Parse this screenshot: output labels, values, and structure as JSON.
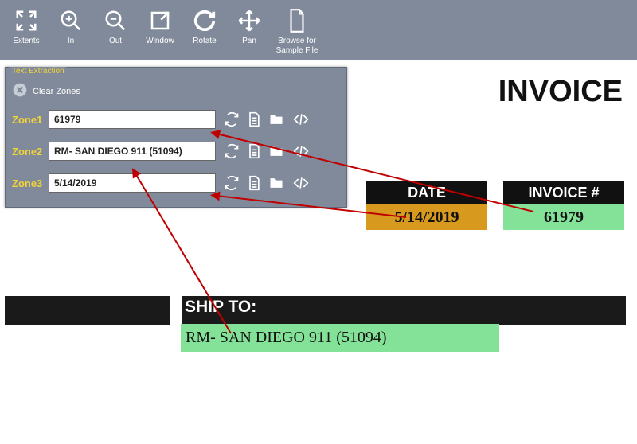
{
  "toolbar": {
    "extents": "Extents",
    "in": "In",
    "out": "Out",
    "window": "Window",
    "rotate": "Rotate",
    "pan": "Pan",
    "browse": "Browse for Sample File"
  },
  "panel": {
    "legend": "Text Extraction",
    "clear": "Clear Zones",
    "rows": [
      {
        "label": "Zone1",
        "value": "61979"
      },
      {
        "label": "Zone2",
        "value": "RM- SAN DIEGO 911 (51094)"
      },
      {
        "label": "Zone3",
        "value": "5/14/2019"
      }
    ]
  },
  "doc": {
    "title": "INVOICE",
    "date_label": "DATE",
    "invoice_label": "INVOICE #",
    "date_value": "5/14/2019",
    "invoice_value": "61979",
    "shipto_label": "SHIP TO:",
    "shipto_value": "RM- SAN DIEGO 911 (51094)"
  }
}
